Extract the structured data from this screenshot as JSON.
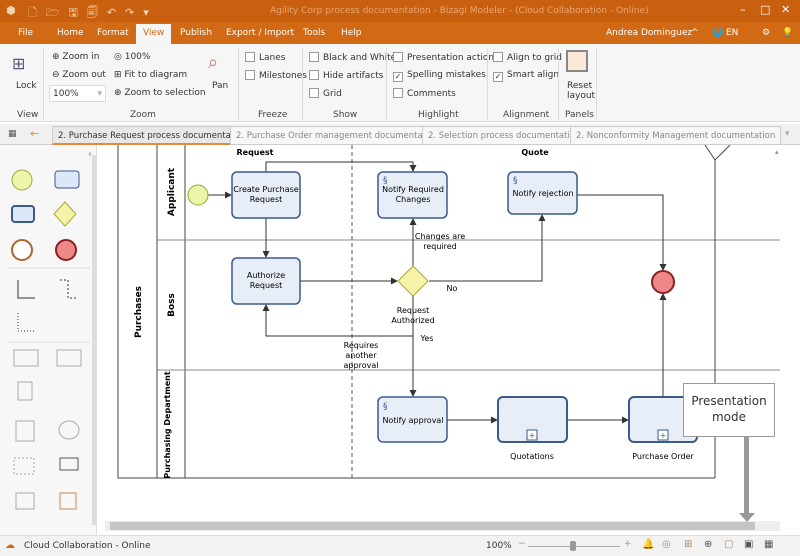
{
  "window": {
    "title": "Agility Corp process documentation - Bizagi Modeler - (Cloud Collaboration - Online)"
  },
  "menu": {
    "items": [
      "File",
      "Home",
      "Format",
      "View",
      "Publish",
      "Export / Import",
      "Tools",
      "Help"
    ],
    "active": "View",
    "user": "Andrea Dominguez",
    "language": "EN"
  },
  "ribbon": {
    "view": {
      "lock": "Lock",
      "group": "View"
    },
    "zoom": {
      "zoom_in": "Zoom in",
      "zoom_out": "Zoom out",
      "zoom_value": "100%",
      "hundred": "100%",
      "fit": "Fit to diagram",
      "selection": "Zoom to selection",
      "pan": "Pan",
      "group": "Zoom"
    },
    "freeze": {
      "lanes": "Lanes",
      "milestones": "Milestones",
      "group": "Freeze",
      "lanes_checked": false,
      "milestones_checked": false
    },
    "show": {
      "bw": "Black and White",
      "hide": "Hide artifacts",
      "grid": "Grid",
      "group": "Show"
    },
    "highlight": {
      "presentation": "Presentation actions",
      "spelling": "Spelling mistakes",
      "comments": "Comments",
      "group": "Highlight",
      "spelling_checked": true
    },
    "alignment": {
      "grid": "Align to grid",
      "smart": "Smart align",
      "group": "Alignment",
      "smart_checked": true
    },
    "panels": {
      "reset1": "Reset",
      "reset2": "layout",
      "group": "Panels"
    }
  },
  "tabs": [
    "2. Purchase Request process documentation",
    "2. Purchase Order management documentation",
    "2. Selection process documentation",
    "2. Nonconformity Management documentation"
  ],
  "diagram": {
    "pool": "Purchases",
    "lanes": [
      "Applicant",
      "Boss",
      "Purchasing Department"
    ],
    "milestones": [
      "Request",
      "Quote"
    ],
    "tasks": {
      "create1": "Create Purchase",
      "create2": "Request",
      "notify1": "Notify Required",
      "notify2": "Changes",
      "reject": "Notify rejection",
      "auth1": "Authorize",
      "auth2": "Request",
      "approval": "Notify approval",
      "quotations": "Quotations",
      "po": "Purchase Order"
    },
    "labels": {
      "changes1": "Changes are",
      "changes2": "required",
      "no": "No",
      "req1": "Request",
      "req2": "Authorized",
      "yes": "Yes",
      "another1": "Requires",
      "another2": "another",
      "another3": "approval"
    }
  },
  "tooltip": {
    "line1": "Presentation",
    "line2": "mode"
  },
  "status": {
    "text": "Cloud Collaboration - Online",
    "zoom": "100%"
  },
  "colors": {
    "accent": "#d26a15",
    "task_fill": "#e8eef8",
    "task_stroke": "#3a5a8a"
  }
}
